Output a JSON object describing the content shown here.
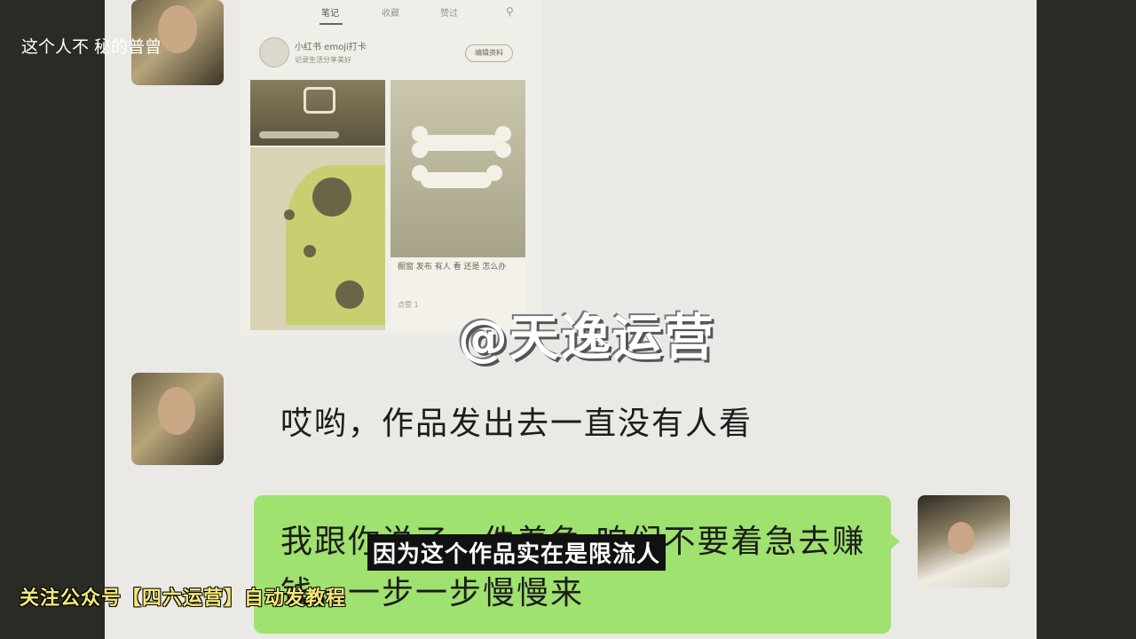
{
  "overlay": {
    "top_caption": "这个人不 秘的普曾",
    "watermark": "@天逸运营",
    "subtitle": "因为这个作品实在是限流人",
    "bottom_caption": "关注公众号【四六运营】自动发教程"
  },
  "screenshot": {
    "tabs": [
      "笔记",
      "收藏",
      "赞过"
    ],
    "search_icon": "search-icon",
    "profile_name": "小红书 emoji打卡",
    "profile_sub": "记录生活分享美好",
    "profile_button": "编辑资料",
    "tile_caption": "橱窗 发布 有人 看 还是 怎么办",
    "tile_meta": "点赞 1"
  },
  "chat": {
    "message_received": "哎哟，作品发出去一直没有人看",
    "message_sent": "我跟你说了一件着急 咱们不要着急去赚钱，一步一步慢慢来"
  },
  "colors": {
    "bubble_green": "#9fe26f",
    "chat_bg": "#ebe9e6",
    "frame_bg": "#2b2b26"
  }
}
